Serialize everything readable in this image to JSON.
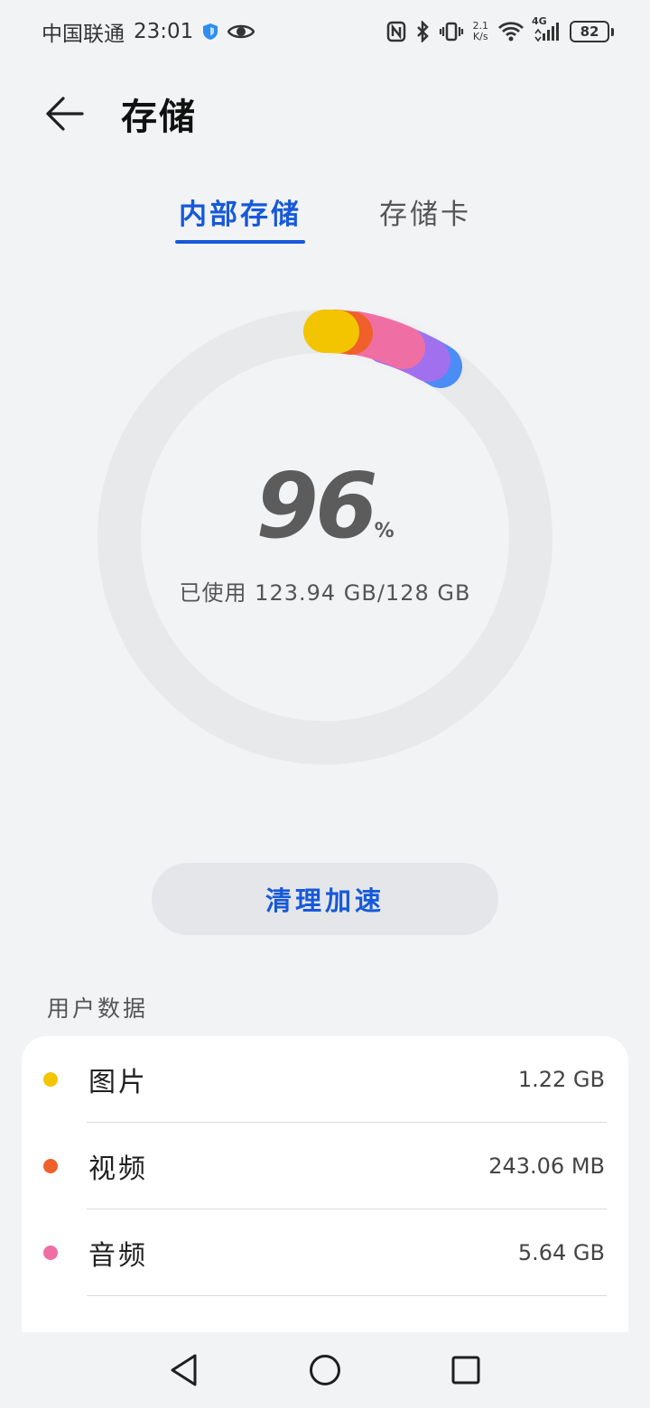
{
  "status_bar": {
    "carrier": "中国联通",
    "time": "23:01",
    "speed_value": "2.1",
    "speed_unit": "K/s",
    "network": "4G",
    "battery": "82"
  },
  "header": {
    "title": "存储"
  },
  "tabs": [
    {
      "label": "内部存储",
      "active": true
    },
    {
      "label": "存储卡",
      "active": false
    }
  ],
  "usage": {
    "percent": "96",
    "percent_sign": "%",
    "used_text": "已使用 123.94 GB/128 GB"
  },
  "clean_button": {
    "label": "清理加速"
  },
  "user_data": {
    "section_title": "用户数据",
    "items": [
      {
        "label": "图片",
        "value": "1.22 GB",
        "color": "#f2c500"
      },
      {
        "label": "视频",
        "value": "243.06 MB",
        "color": "#f0602a"
      },
      {
        "label": "音频",
        "value": "5.64 GB",
        "color": "#ef6fa5"
      }
    ]
  },
  "colors": {
    "accent": "#1659d9",
    "ring_track": "#e8e9eb",
    "ring_blue": "#4b8cf5",
    "ring_purple": "#9b6ff0"
  }
}
